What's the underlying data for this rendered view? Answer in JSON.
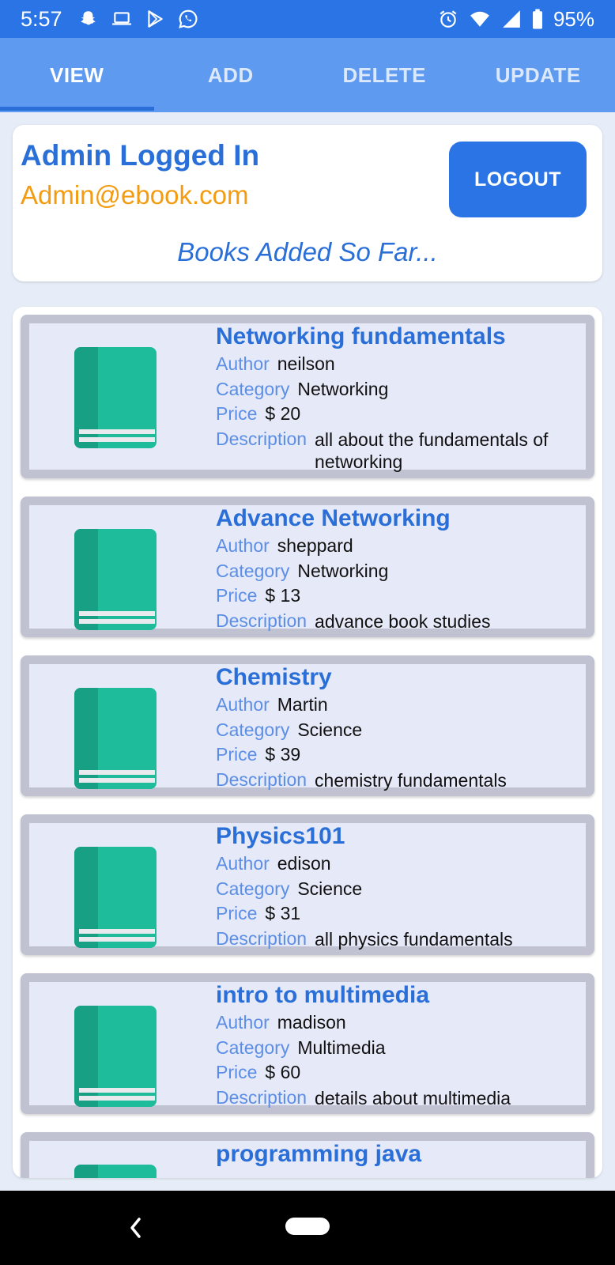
{
  "status_bar": {
    "time": "5:57",
    "left_icons": [
      "snapchat-icon",
      "laptop-icon",
      "play-store-icon",
      "whatsapp-icon"
    ],
    "right_icons": [
      "alarm-icon",
      "wifi-icon",
      "signal-icon",
      "battery-icon"
    ],
    "battery": "95%"
  },
  "tabs": [
    {
      "label": "VIEW",
      "active": true
    },
    {
      "label": "ADD",
      "active": false
    },
    {
      "label": "DELETE",
      "active": false
    },
    {
      "label": "UPDATE",
      "active": false
    }
  ],
  "header": {
    "title": "Admin Logged In",
    "email": "Admin@ebook.com",
    "logout_label": "LOGOUT",
    "subtitle": "Books Added So Far..."
  },
  "field_labels": {
    "author": "Author",
    "category": "Category",
    "price": "Price",
    "description": "Description"
  },
  "books": [
    {
      "title": "Networking fundamentals",
      "author": "neilson",
      "category": "Networking",
      "price": "$ 20",
      "description": "all about the fundamentals of networking"
    },
    {
      "title": "Advance Networking",
      "author": "sheppard",
      "category": "Networking",
      "price": "$ 13",
      "description": "advance book studies"
    },
    {
      "title": "Chemistry",
      "author": "Martin",
      "category": "Science",
      "price": "$ 39",
      "description": "chemistry fundamentals"
    },
    {
      "title": "Physics101",
      "author": "edison",
      "category": "Science",
      "price": "$ 31",
      "description": "all physics fundamentals"
    },
    {
      "title": "intro to multimedia",
      "author": "madison",
      "category": "Multimedia",
      "price": "$ 60",
      "description": "details about multimedia"
    },
    {
      "title": "programming java",
      "author": "",
      "category": "",
      "price": "",
      "description": ""
    }
  ],
  "colors": {
    "status_bar": "#2a74e6",
    "tab_bar": "#5f9af1",
    "accent": "#2a6fd8",
    "email": "#f39c12",
    "book_green": "#1ebc9b"
  }
}
